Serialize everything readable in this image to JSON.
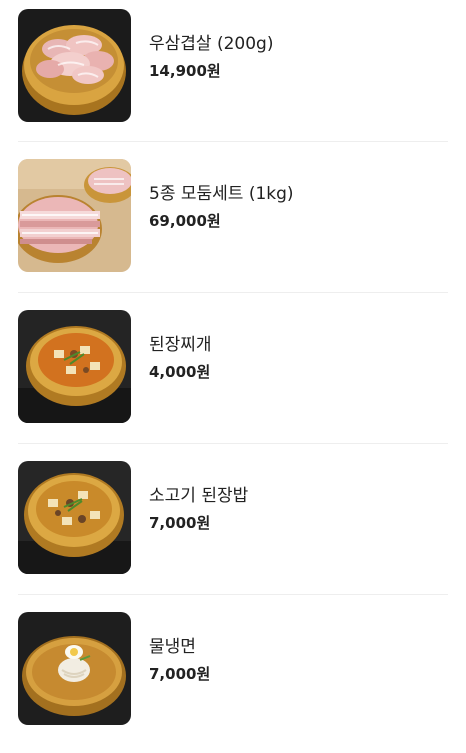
{
  "menu": {
    "items": [
      {
        "name": "우삼겹살 (200g)",
        "price": "14,900원",
        "image": "sliced-pork-in-brass-bowl"
      },
      {
        "name": "5종 모둠세트 (1kg)",
        "price": "69,000원",
        "image": "assorted-pork-platter"
      },
      {
        "name": "된장찌개",
        "price": "4,000원",
        "image": "soybean-paste-stew"
      },
      {
        "name": "소고기 된장밥",
        "price": "7,000원",
        "image": "beef-soybean-rice-stew"
      },
      {
        "name": "물냉면",
        "price": "7,000원",
        "image": "cold-noodle-soup"
      }
    ]
  },
  "colors": {
    "text": "#222222",
    "divider": "#eeeeee",
    "brass": "#c8942e"
  }
}
